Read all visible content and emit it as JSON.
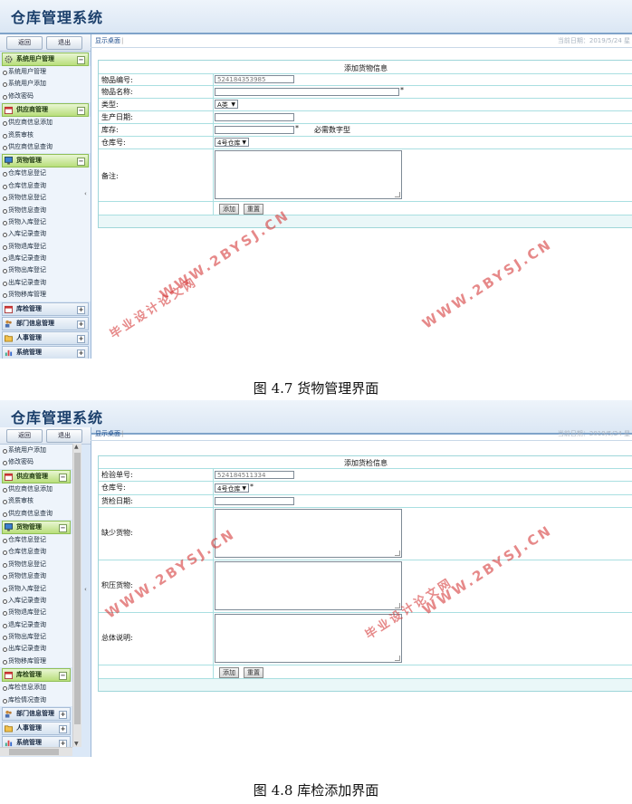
{
  "app_title": "仓库管理系统",
  "nav": {
    "back_label": "返回",
    "exit_label": "退出"
  },
  "breadcrumb": "显示桌面",
  "date_text": "当前日期：2019/5/24 星",
  "shot1": {
    "sidebar": [
      {
        "type": "section",
        "label": "系统用户管理",
        "icon": "gear-icon",
        "expanded": true
      },
      {
        "type": "item",
        "label": "系统用户管理"
      },
      {
        "type": "item",
        "label": "系统用户添加"
      },
      {
        "type": "item",
        "label": "修改密码"
      },
      {
        "type": "section",
        "label": "供应商管理",
        "icon": "calendar-icon",
        "expanded": true
      },
      {
        "type": "item",
        "label": "供应商信息添加"
      },
      {
        "type": "item",
        "label": "资质审核"
      },
      {
        "type": "item",
        "label": "供应商信息查询"
      },
      {
        "type": "section",
        "label": "货物管理",
        "icon": "monitor-icon",
        "expanded": true
      },
      {
        "type": "item",
        "label": "仓库信息登记"
      },
      {
        "type": "item",
        "label": "仓库信息查询"
      },
      {
        "type": "item",
        "label": "货物信息登记"
      },
      {
        "type": "item",
        "label": "货物信息查询"
      },
      {
        "type": "item",
        "label": "货物入库登记"
      },
      {
        "type": "item",
        "label": "入库记录查询"
      },
      {
        "type": "item",
        "label": "货物退库登记"
      },
      {
        "type": "item",
        "label": "退库记录查询"
      },
      {
        "type": "item",
        "label": "货物出库登记"
      },
      {
        "type": "item",
        "label": "出库记录查询"
      },
      {
        "type": "item",
        "label": "货物移库管理"
      },
      {
        "type": "section",
        "label": "库检管理",
        "icon": "calendar-icon",
        "expanded": false
      },
      {
        "type": "section",
        "label": "部门信息管理",
        "icon": "people-icon",
        "expanded": false
      },
      {
        "type": "section",
        "label": "人事管理",
        "icon": "folder-icon",
        "expanded": false
      },
      {
        "type": "section",
        "label": "系统管理",
        "icon": "chart-icon",
        "expanded": false
      }
    ],
    "form": {
      "title": "添加货物信息",
      "fields": {
        "code": {
          "label": "物品编号:",
          "value": "524184353985"
        },
        "name": {
          "label": "物品名称:",
          "required": "*"
        },
        "type": {
          "label": "类型:",
          "value": "A类"
        },
        "prod_date": {
          "label": "生产日期:"
        },
        "stock": {
          "label": "库存:",
          "required": "*",
          "hint": "必需数字型"
        },
        "warehouse": {
          "label": "仓库号:",
          "value": "4号仓库"
        },
        "remark": {
          "label": "备注:"
        }
      },
      "add_button": "添加",
      "reset_button": "重置"
    },
    "caption": "图 4.7 货物管理界面"
  },
  "shot2": {
    "sidebar": [
      {
        "type": "item",
        "label": "系统用户添加"
      },
      {
        "type": "item",
        "label": "修改密码"
      },
      {
        "type": "section",
        "label": "供应商管理",
        "icon": "calendar-icon",
        "expanded": true
      },
      {
        "type": "item",
        "label": "供应商信息添加"
      },
      {
        "type": "item",
        "label": "资质审核"
      },
      {
        "type": "item",
        "label": "供应商信息查询"
      },
      {
        "type": "section",
        "label": "货物管理",
        "icon": "monitor-icon",
        "expanded": true
      },
      {
        "type": "item",
        "label": "仓库信息登记"
      },
      {
        "type": "item",
        "label": "仓库信息查询"
      },
      {
        "type": "item",
        "label": "货物信息登记"
      },
      {
        "type": "item",
        "label": "货物信息查询"
      },
      {
        "type": "item",
        "label": "货物入库登记"
      },
      {
        "type": "item",
        "label": "入库记录查询"
      },
      {
        "type": "item",
        "label": "货物退库登记"
      },
      {
        "type": "item",
        "label": "退库记录查询"
      },
      {
        "type": "item",
        "label": "货物出库登记"
      },
      {
        "type": "item",
        "label": "出库记录查询"
      },
      {
        "type": "item",
        "label": "货物移库管理"
      },
      {
        "type": "section",
        "label": "库检管理",
        "icon": "calendar-icon",
        "expanded": true
      },
      {
        "type": "item",
        "label": "库检信息添加"
      },
      {
        "type": "item",
        "label": "库检情况查询"
      },
      {
        "type": "section",
        "label": "部门信息管理",
        "icon": "people-icon",
        "expanded": false
      },
      {
        "type": "section",
        "label": "人事管理",
        "icon": "folder-icon",
        "expanded": false
      },
      {
        "type": "section",
        "label": "系统管理",
        "icon": "chart-icon",
        "expanded": false
      }
    ],
    "form": {
      "title": "添加货检信息",
      "fields": {
        "code": {
          "label": "检验单号:",
          "value": "524184511334"
        },
        "warehouse": {
          "label": "仓库号:",
          "value": "4号仓库",
          "required": "*"
        },
        "check_date": {
          "label": "货检日期:"
        },
        "missing": {
          "label": "缺少货物:"
        },
        "overstock": {
          "label": "积压货物:"
        },
        "summary": {
          "label": "总体说明:"
        }
      },
      "add_button": "添加",
      "reset_button": "重置"
    },
    "caption": "图 4.8 库检添加界面"
  },
  "watermarks": {
    "url": "WWW.2BYSJ.CN",
    "cn": "毕业设计论文网"
  },
  "colors": {
    "banner": "#dbe7f4",
    "sidebar": "#dbe8f7",
    "section_active": "#b8de7a",
    "form_border": "#a9dfe1",
    "watermark": "#d22828",
    "title": "#1b3f6b"
  }
}
